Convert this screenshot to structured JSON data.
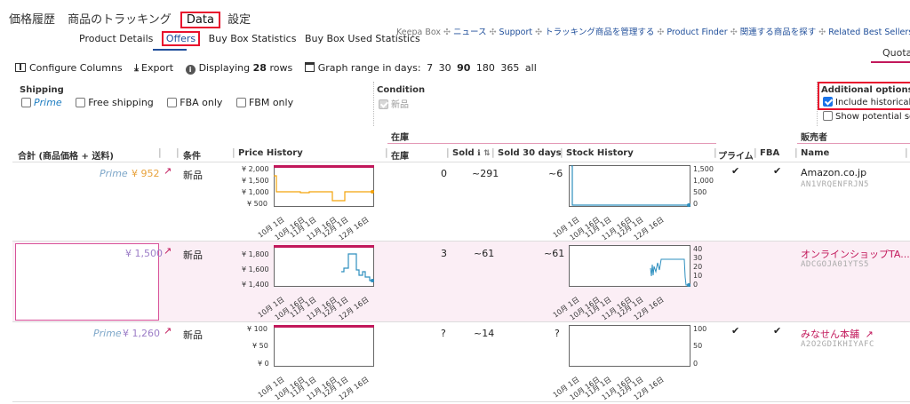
{
  "top_tabs": [
    "価格履歴",
    "商品のトラッキング",
    "Data",
    "設定"
  ],
  "sub_tabs": [
    "Product Details",
    "Offers",
    "Buy Box Statistics",
    "Buy Box Used Statistics"
  ],
  "top_links": [
    "Keepa Box",
    "ニュース",
    "Support",
    "トラッキング商品を管理する",
    "Product Finder",
    "関連する商品を探す",
    "Related Best Sellers"
  ],
  "quota_label": "Quota",
  "toolbar": {
    "configure_columns": "Configure Columns",
    "export": "Export",
    "displaying_prefix": "Displaying",
    "displaying_count": "28",
    "displaying_suffix": "rows",
    "graph_range_label": "Graph range in days:",
    "graph_ranges": [
      "7",
      "30",
      "90",
      "180",
      "365",
      "all"
    ],
    "graph_range_selected": "90"
  },
  "filters": {
    "shipping_title": "Shipping",
    "shipping_options": [
      "Prime",
      "Free shipping",
      "FBA only",
      "FBM only"
    ],
    "condition_title": "Condition",
    "condition_option": "新品",
    "additional_title": "Additional options",
    "additional_options": [
      "Include historical o",
      "Show potential sca"
    ]
  },
  "table": {
    "group_stock": "在庫",
    "group_seller": "販売者",
    "headers": {
      "total": "合計 (商品価格 + 送料)",
      "condition": "条件",
      "price_history": "Price History",
      "stock": "在庫",
      "sold": "Sold",
      "sold30": "Sold 30 days",
      "stock_history": "Stock History",
      "prime": "プライム",
      "fba": "FBA",
      "name": "Name"
    },
    "date_ticks": [
      "10月 1日",
      "10月 16日",
      "11月 1日",
      "11月 16日",
      "12月 1日",
      "12月 16日"
    ],
    "rows": [
      {
        "prime": "Prime",
        "price": "¥ 952",
        "condition": "新品",
        "stock": "0",
        "sold": "~291",
        "sold30": "~6",
        "prime_check": "✔",
        "fba_check": "✔",
        "seller_name": "Amazon.co.jp",
        "seller_id": "AN1VRQENFRJN5",
        "price_axis": [
          "¥ 2,000",
          "¥ 1,500",
          "¥ 1,000",
          "¥ 500"
        ],
        "stock_axis": [
          "1,500",
          "1,000",
          "500",
          "0"
        ]
      },
      {
        "prime": "",
        "price": "¥ 1,500",
        "condition": "新品",
        "stock": "3",
        "sold": "~61",
        "sold30": "~61",
        "prime_check": "",
        "fba_check": "",
        "seller_name": "オンラインショップTA...",
        "seller_id": "ADCGOJA01YTS5",
        "price_axis": [
          "¥ 1,800",
          "¥ 1,600",
          "¥ 1,400"
        ],
        "stock_axis": [
          "40",
          "30",
          "20",
          "10",
          "0"
        ]
      },
      {
        "prime": "Prime",
        "price": "¥ 1,260",
        "condition": "新品",
        "stock": "?",
        "sold": "~14",
        "sold30": "?",
        "prime_check": "✔",
        "fba_check": "✔",
        "seller_name": "みなせん本舗",
        "seller_id": "A2O2GDIKHIYAFC",
        "price_axis": [
          "¥ 100",
          "¥ 50",
          "¥ 0"
        ],
        "stock_axis": [
          "100",
          "50",
          "0"
        ]
      }
    ]
  },
  "colors": {
    "accent_pink": "#c2185b",
    "price_line": "#f4a30b",
    "stock_line": "#2e8fbf",
    "highlight_row": "#fbeef5",
    "red_box": "#e8112d"
  }
}
